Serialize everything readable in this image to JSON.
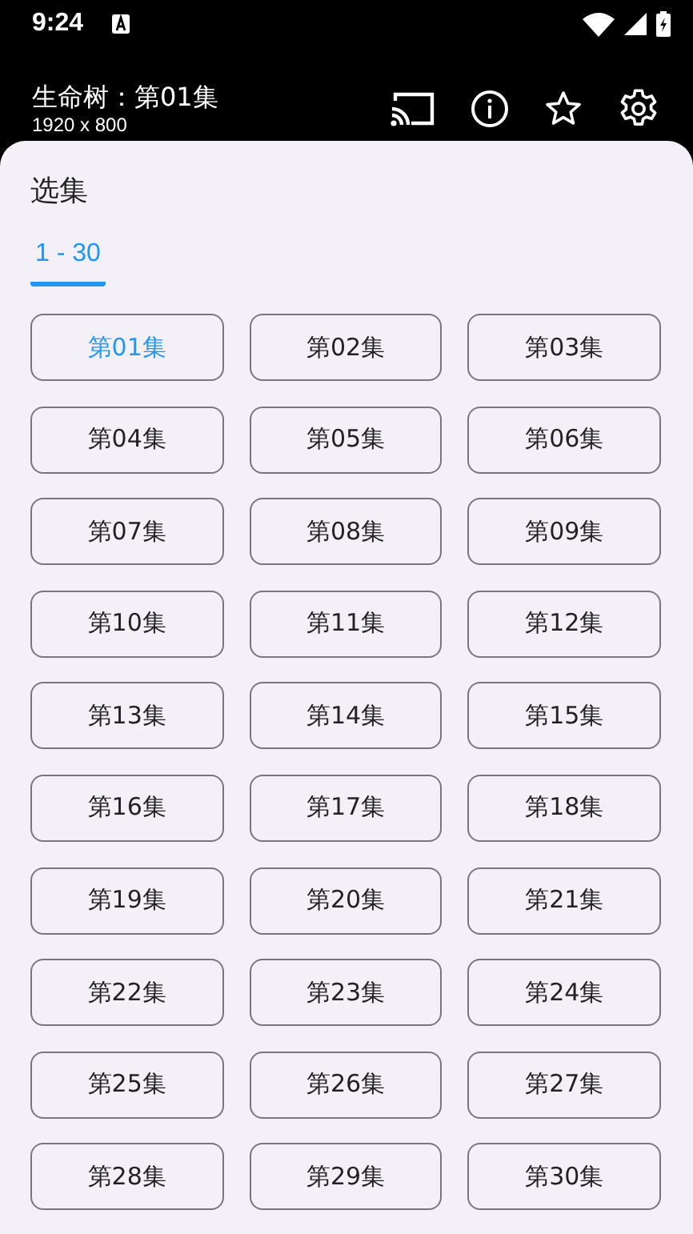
{
  "status_bar": {
    "time": "9:24"
  },
  "header": {
    "title": "生命树：第01集",
    "subtitle": "1920 x 800"
  },
  "sheet": {
    "title": "选集",
    "tabs": [
      {
        "label": "1 - 30",
        "selected": true
      }
    ],
    "episodes": [
      {
        "label": "第01集",
        "selected": true
      },
      {
        "label": "第02集",
        "selected": false
      },
      {
        "label": "第03集",
        "selected": false
      },
      {
        "label": "第04集",
        "selected": false
      },
      {
        "label": "第05集",
        "selected": false
      },
      {
        "label": "第06集",
        "selected": false
      },
      {
        "label": "第07集",
        "selected": false
      },
      {
        "label": "第08集",
        "selected": false
      },
      {
        "label": "第09集",
        "selected": false
      },
      {
        "label": "第10集",
        "selected": false
      },
      {
        "label": "第11集",
        "selected": false
      },
      {
        "label": "第12集",
        "selected": false
      },
      {
        "label": "第13集",
        "selected": false
      },
      {
        "label": "第14集",
        "selected": false
      },
      {
        "label": "第15集",
        "selected": false
      },
      {
        "label": "第16集",
        "selected": false
      },
      {
        "label": "第17集",
        "selected": false
      },
      {
        "label": "第18集",
        "selected": false
      },
      {
        "label": "第19集",
        "selected": false
      },
      {
        "label": "第20集",
        "selected": false
      },
      {
        "label": "第21集",
        "selected": false
      },
      {
        "label": "第22集",
        "selected": false
      },
      {
        "label": "第23集",
        "selected": false
      },
      {
        "label": "第24集",
        "selected": false
      },
      {
        "label": "第25集",
        "selected": false
      },
      {
        "label": "第26集",
        "selected": false
      },
      {
        "label": "第27集",
        "selected": false
      },
      {
        "label": "第28集",
        "selected": false
      },
      {
        "label": "第29集",
        "selected": false
      },
      {
        "label": "第30集",
        "selected": false
      }
    ]
  }
}
